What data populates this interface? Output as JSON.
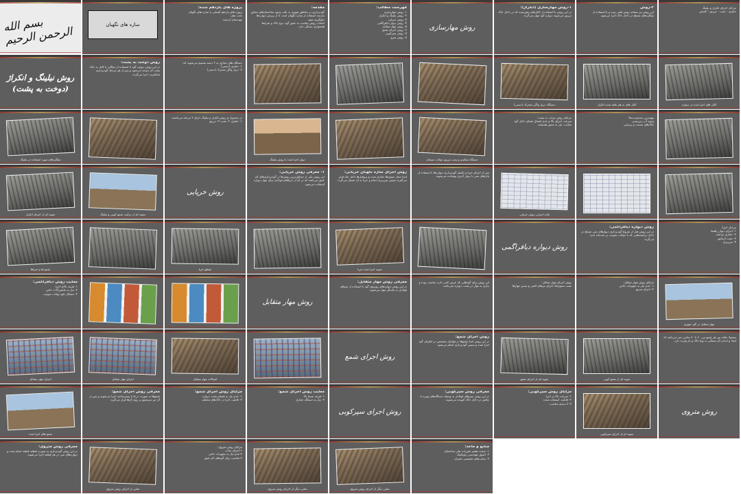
{
  "slides": [
    {
      "kind": "calligraphy",
      "text": "بسم الله الرحمن الرحیم"
    },
    {
      "kind": "whitebox",
      "text": "سازه های نگهبان"
    },
    {
      "kind": "text",
      "head": "پروژه های یازدهم شده:",
      "body": "پروژه های یازدهم آشنایی با سازه های نگهبان\nتحت نظر:\nمهندسان ارجمند"
    },
    {
      "kind": "text",
      "head": "مقدمه:",
      "body": "گودبرداری در مناطق شهری به علت وجود ساختمان‌های مجاور نیازمند استفاده از سازه نگهبان است تا از ریزش دیواره‌ها جلوگیری شود.\nانتخاب روش مناسب به عمق گود، نوع خاک و شرایط همجواری بستگی دارد."
    },
    {
      "kind": "text",
      "head": "فهرست مطالب:",
      "body": "۱- روش مهارسازی\n۲- روش نیلینگ و انکراژ\n۳- روش خرپایی\n۴- روش دیوار دیافراگمی\n۵- روش مهار متقابل\n۶- روش اجرای شمع\n۷- روش سپرکوبی\n۸- روش مترو"
    },
    {
      "kind": "title",
      "text": "روش مهارسازی"
    },
    {
      "kind": "text",
      "head": "۱-روش مهارسازی (انکراژ):",
      "body": "در این روش با استفاده از کابل‌های پیش‌تنیده که در داخل خاک تزریق می‌شوند دیواره گود مهار می‌گردد."
    },
    {
      "kind": "text",
      "head": "۲-روش",
      "body": "این روش نیز مشابه روش قبلی بوده و با استفاده از میلگردهای مسلح در داخل خاک اجرا می‌شود."
    },
    {
      "kind": "text",
      "head": "",
      "body": "مراحل اجرای انکراژ و نیلینگ\nحفاری - نصب - تزریق - کشش"
    },
    {
      "kind": "title",
      "big": true,
      "text": "روش نیلینگ و انکراژ (دوخت به پشت)"
    },
    {
      "kind": "text",
      "head": "روش دوخت به پشت:",
      "body": "در این روش دیواره گود با استفاده از میلگرد یا کابل به خاک پشت آن دوخته می‌شود و پس از هر مرحله گودبرداری شاتکریت اجرا می‌گردد."
    },
    {
      "kind": "text",
      "head": "",
      "body": "دستگاه های حفاری به ۲ دسته تقسیم می‌شوند که:\n۱- حفاری (دستی)\n۲- دریل واگن متحرک (دستی)"
    },
    {
      "kind": "photo",
      "style": "",
      "caption": ""
    },
    {
      "kind": "photo",
      "style": "grey",
      "caption": ""
    },
    {
      "kind": "photo",
      "style": "",
      "caption": ""
    },
    {
      "kind": "photo",
      "style": "",
      "caption": "دستگاه دریل واگن متحرک (دستی)"
    },
    {
      "kind": "photo",
      "style": "grey",
      "caption": "کابل های به هم بافته شده انکراژ"
    },
    {
      "kind": "photo",
      "style": "grey",
      "caption": "کابل های اجرا شده در دیواره"
    },
    {
      "kind": "photo",
      "style": "grey",
      "caption": "میلگردهای مورد استفاده در نیلینگ"
    },
    {
      "kind": "photo",
      "style": "",
      "caption": ""
    },
    {
      "kind": "text",
      "head": "",
      "body": "در مجموع دو روش انکراژ و نیلینگ دارای ۳ مرحله می‌باشند:\n۱- حفاری ۲- نصب ۳- تزریق"
    },
    {
      "kind": "photo",
      "style": "sunset",
      "caption": "دیوار اجرا شده با روش نیلینگ"
    },
    {
      "kind": "photo",
      "style": "",
      "caption": ""
    },
    {
      "kind": "photo",
      "style": "",
      "caption": "دستگاه میکسر و پمپ تزریق دوغاب سیمان"
    },
    {
      "kind": "text",
      "head": "",
      "body": "مزایای روش دوخت به پشت:\nسرعت اجرای بالا و عدم اشغال فضای داخل گود\nمعایب: نیاز به مجوز همسایه"
    },
    {
      "kind": "text",
      "head": "",
      "body": "مهم‌ترین محدودیت‌ها:\nوجود آب زیرزمینی\nخاک‌های سست و ریزشی"
    },
    {
      "kind": "photo",
      "style": "grey",
      "caption": ""
    },
    {
      "kind": "photo",
      "style": "grey",
      "caption": "نمونه ای از اجرای انکراژ"
    },
    {
      "kind": "photo",
      "style": "sky",
      "caption": "نمونه ای از ترکیب شمع کوبی و نیلینگ"
    },
    {
      "kind": "title",
      "text": "روش خرپایی"
    },
    {
      "kind": "text",
      "head": "۱- معرفی روش خرپایی:",
      "body": "این روش یکی از متداول‌ترین روش‌ها در گودبرداری‌های کم عمق می‌باشد که در آن از خرپاهای فولادی برای مهار دیواره استفاده می‌شود."
    },
    {
      "kind": "text",
      "head": "روش اجرای سازه نگهبان خرپایی:",
      "body": "ابتدا محل ستون‌ها حفاری شده و پروفیل‌ها داخل چاه قرار می‌گیرند سپس بتن‌ریزی انجام و خرپا به آن متصل می‌گردد."
    },
    {
      "kind": "text",
      "head": "",
      "body": "پس از اجرای خرپا و تکمیل گودبرداری دیواره‌ها با استفاده از پانل‌های بتنی یا دیوار آجری پوشانده می‌شوند."
    },
    {
      "kind": "photo",
      "style": "dia",
      "caption": "پلان اجرایی روش خرپایی"
    },
    {
      "kind": "photo",
      "style": "dia",
      "caption": ""
    },
    {
      "kind": "photo",
      "style": "grey",
      "caption": ""
    },
    {
      "kind": "photo",
      "style": "grey",
      "caption": "شمع ها و خرپاها"
    },
    {
      "kind": "photo",
      "style": "grey",
      "caption": ""
    },
    {
      "kind": "photo",
      "style": "grey",
      "caption": "مقطع خرپا"
    },
    {
      "kind": "photo",
      "style": "grey",
      "caption": ""
    },
    {
      "kind": "photo",
      "style": "",
      "caption": "نمونه اجرا شده خرپا"
    },
    {
      "kind": "photo",
      "style": "grey",
      "caption": ""
    },
    {
      "kind": "title",
      "text": "روش دیواره دیافراگمی"
    },
    {
      "kind": "text",
      "head": "روش دیواره دیافراگمی:",
      "body": "در این روش قبل از شروع گودبرداری دیوارهای بتنی مسلح در داخل ترانشه‌هایی که با دوغاب بنتونیت پر شده‌اند اجرا می‌گردد."
    },
    {
      "kind": "text",
      "head": "",
      "body": "مراحل اجرا:\n۱- اجرای دیوار راهنما\n۲- حفاری ترانشه\n۳- نصب آرماتور\n۴- بتن‌ریزی"
    },
    {
      "kind": "text",
      "head": "معایب روش دیافراگمی:",
      "body": "۱- هزینه بالای اجرا\n۲- نیاز به ماشین‌آلات خاص\n۳- مشکل دفع دوغاب بنتونیت"
    },
    {
      "kind": "photo",
      "style": "colorful",
      "caption": ""
    },
    {
      "kind": "photo",
      "style": "colorful",
      "caption": ""
    },
    {
      "kind": "title",
      "text": "روش مهار متقابل"
    },
    {
      "kind": "text",
      "head": "معرفی روش مهار متقابل:",
      "body": "در این روش دیواره‌های روبروی گود با استفاده از تیرهای فولادی به یکدیگر مهار می‌شوند."
    },
    {
      "kind": "text",
      "head": "",
      "body": "این روش برای گودهایی که عرض کمی دارند مناسب بوده و نیازی به مهار در پشت دیواره نمی‌باشد."
    },
    {
      "kind": "text",
      "head": "",
      "body": "روش اجرای مهار متقابل:\nنصب ستون‌ها، اجرای تیرهای افقی و بستن مهارها"
    },
    {
      "kind": "text",
      "head": "",
      "body": "مزایای روش مهار متقابل:\n۱- عدم نیاز به تجهیزات خاص\n۲- اجرای سریع"
    },
    {
      "kind": "photo",
      "style": "sky",
      "caption": "مهار متقابل در گود شهری"
    },
    {
      "kind": "photo",
      "style": "blue",
      "caption": "اجرای مهار متقابل"
    },
    {
      "kind": "photo",
      "style": "blue",
      "caption": "اجرای مهار متقابل"
    },
    {
      "kind": "photo",
      "style": "",
      "caption": "اتصالات مهار متقابل"
    },
    {
      "kind": "photo",
      "style": "blue",
      "caption": ""
    },
    {
      "kind": "title",
      "text": "روش اجرای شمع"
    },
    {
      "kind": "text",
      "head": "روش اجرای شمع:",
      "body": "در این روش ابتدا شمع‌ها در فواصل مشخص در اطراف گود اجرا شده و سپس گودبرداری انجام می‌شود."
    },
    {
      "kind": "photo",
      "style": "grey",
      "caption": "نمونه ای از اجرای شمع"
    },
    {
      "kind": "photo",
      "style": "grey",
      "caption": "نمونه ای از شمع کوبی"
    },
    {
      "kind": "text",
      "head": "",
      "body": "معمولا دهانه بین هر شمع بین ۶۰ تا ۹۰ سانتی متر می‌باشد که ابعاد و اندازه آن بستگی به نوع خاک و بار وارده دارد."
    },
    {
      "kind": "photo",
      "style": "sky",
      "caption": "شمع های اجرا شده"
    },
    {
      "kind": "text",
      "head": "معرفی روش اجرای شمع:",
      "body": "شمع‌ها به صورت درجا یا پیش‌ساخته اجرا می‌شوند و پس از آن تیر سرشمع بر روی آن‌ها قرار می‌گیرد."
    },
    {
      "kind": "text",
      "head": "مزایای روش اجرای شمع:",
      "body": "۱- عدم نیاز به فضای پشت دیواره\n۲- قابلیت اجرا در خاک‌های مختلف"
    },
    {
      "kind": "text",
      "head": "معایب روش اجرای شمع:",
      "body": "۱- هزینه نسبتا بالا\n۲- نیاز به دستگاه حفاری"
    },
    {
      "kind": "title",
      "text": "روش اجرای سپرکوبی"
    },
    {
      "kind": "text",
      "head": "معرفی روش سپرکوبی:",
      "body": "در این روش سپرهای فولادی به وسیله دستگاه‌های ویبره یا چکش در داخل خاک کوبیده می‌شوند."
    },
    {
      "kind": "text",
      "head": "مزایای روش سپرکوبی:",
      "body": "۱- سرعت بالا در اجرا\n۲- قابلیت استفاده مجدد\n۳- آب‌بندی مناسب"
    },
    {
      "kind": "photo",
      "style": "",
      "caption": "نمونه ای از اجرای سپرکوبی"
    },
    {
      "kind": "title",
      "text": "روش متروی"
    },
    {
      "kind": "text",
      "head": "معرفی روش متروی:",
      "body": "در این روش گودبرداری به صورت قطعه قطعه انجام شده و دیواره‌های بتنی در هر قطعه اجرا می‌شوند."
    },
    {
      "kind": "photo",
      "style": "",
      "caption": "نمایی از اجرای روش متروی"
    },
    {
      "kind": "text",
      "head": "",
      "body": "مزایای روش متروی:\n۱-اجرای ساده\n۲-عدم نیاز به تجهیزات خاص\n۳-مناسب برای گودهای کم عمق"
    },
    {
      "kind": "photo",
      "style": "",
      "caption": "نمایی دیگر از اجرای روش متروی"
    },
    {
      "kind": "photo",
      "style": "",
      "caption": "نمایی دیگر از اجرای روش متروی"
    },
    {
      "kind": "text",
      "head": "منابع و مآخذ:",
      "body": "۱- مبحث هفتم مقررات ملی ساختمان\n۲- اصول مهندسی ژئوتکنیک\n۳- سایت‌های تخصصی عمران"
    },
    {
      "kind": "blank"
    },
    {
      "kind": "blank"
    },
    {
      "kind": "blank"
    }
  ]
}
